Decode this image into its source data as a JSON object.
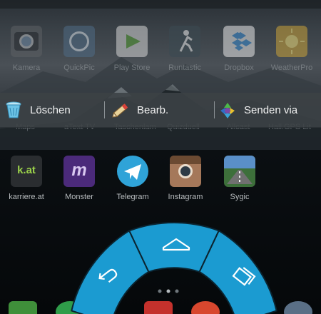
{
  "top_apps": [
    {
      "label": "Kamera",
      "icon": "camera-icon"
    },
    {
      "label": "QuickPic",
      "icon": "quickpic-icon"
    },
    {
      "label": "Play Store",
      "icon": "play-store-icon"
    },
    {
      "label": "Runtastic",
      "icon": "runtastic-icon"
    },
    {
      "label": "Dropbox",
      "icon": "dropbox-icon"
    },
    {
      "label": "WeatherPro",
      "icon": "weatherpro-icon"
    }
  ],
  "action_bar": {
    "delete": {
      "label": "Löschen",
      "icon": "trash-icon"
    },
    "edit": {
      "label": "Bearb.",
      "icon": "pencil-icon"
    },
    "share": {
      "label": "Senden via",
      "icon": "share-icon"
    }
  },
  "hidden_labels": [
    "Maps",
    "aText TV",
    "Taschenlam",
    "Quizduell",
    "Allcast",
    "Hall.GPS Lit"
  ],
  "second_row_apps": [
    {
      "label": "karriere.at",
      "icon": "karriere-icon",
      "logo_text": "k.at"
    },
    {
      "label": "Monster",
      "icon": "monster-icon",
      "logo_text": "m"
    },
    {
      "label": "Telegram",
      "icon": "telegram-icon"
    },
    {
      "label": "Instagram",
      "icon": "instagram-icon"
    },
    {
      "label": "Sygic",
      "icon": "sygic-icon"
    }
  ],
  "pie_controls": {
    "color": "#1b9bd1",
    "segments": [
      "back-icon",
      "home-icon",
      "recent-apps-icon"
    ]
  }
}
